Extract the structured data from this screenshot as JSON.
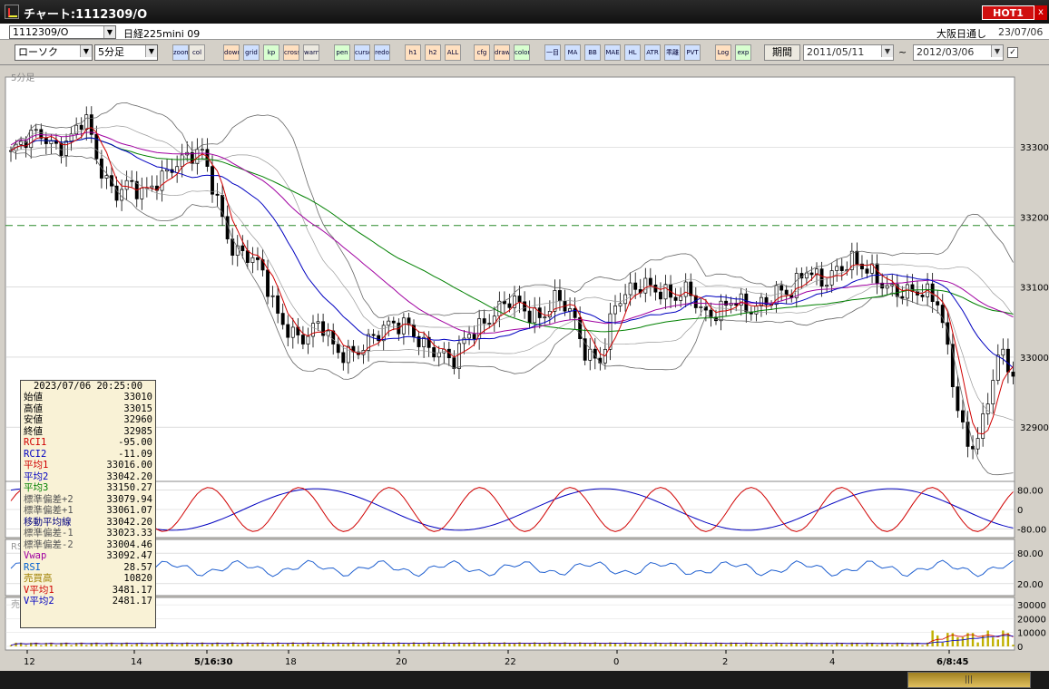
{
  "window": {
    "title": "チャート:1112309/O",
    "hot_label": "HOT1",
    "close_label": "x"
  },
  "header": {
    "code": "1112309/O",
    "name": "日経225mini 09",
    "market": "大阪日通し",
    "date": "23/07/06"
  },
  "toolbar": {
    "chart_type": "ローソク",
    "interval": "5分足",
    "period_label": "期間",
    "from_date": "2011/05/11",
    "to_date": "2012/03/06",
    "tilde": "~",
    "buttons": [
      "zoom",
      "col",
      "down",
      "grid",
      "kp",
      "cross",
      "warn",
      "pen",
      "cursor",
      "redo",
      "h1",
      "h2",
      "ALL",
      "cfg",
      "draw",
      "color",
      "一目",
      "MA",
      "BB",
      "MAE",
      "HL",
      "ATR",
      "乖離",
      "PVT",
      "Log",
      "exp"
    ]
  },
  "info_panel": {
    "timestamp": "2023/07/06  20:25:00",
    "rows": [
      {
        "label": "始値",
        "value": "33010",
        "color": "#000000"
      },
      {
        "label": "高値",
        "value": "33015",
        "color": "#000000"
      },
      {
        "label": "安値",
        "value": "32960",
        "color": "#000000"
      },
      {
        "label": "終値",
        "value": "32985",
        "color": "#000000"
      },
      {
        "label": "RCI1",
        "value": "-95.00",
        "color": "#d00000"
      },
      {
        "label": "RCI2",
        "value": "-11.09",
        "color": "#0000c0"
      },
      {
        "label": "平均1",
        "value": "33016.00",
        "color": "#d00000"
      },
      {
        "label": "平均2",
        "value": "33042.20",
        "color": "#0000c0"
      },
      {
        "label": "平均3",
        "value": "33150.27",
        "color": "#008000"
      },
      {
        "label": "標準偏差+2",
        "value": "33079.94",
        "color": "#555555"
      },
      {
        "label": "標準偏差+1",
        "value": "33061.07",
        "color": "#555555"
      },
      {
        "label": "移動平均線",
        "value": "33042.20",
        "color": "#000080"
      },
      {
        "label": "標準偏差-1",
        "value": "33023.33",
        "color": "#555555"
      },
      {
        "label": "標準偏差-2",
        "value": "33004.46",
        "color": "#555555"
      },
      {
        "label": "Vwap",
        "value": "33092.47",
        "color": "#a000a0"
      },
      {
        "label": "RSI",
        "value": "28.57",
        "color": "#0060d0"
      },
      {
        "label": "売買高",
        "value": "10820",
        "color": "#a08000"
      },
      {
        "label": "V平均1",
        "value": "3481.17",
        "color": "#d00000"
      },
      {
        "label": "V平均2",
        "value": "2481.17",
        "color": "#0000c0"
      }
    ]
  },
  "chart_data": {
    "type": "candlestick",
    "interval_label": "5分足",
    "price_axis": {
      "ticks": [
        33300,
        33200,
        33100,
        33000,
        32900
      ],
      "range": [
        32820,
        33400
      ]
    },
    "reference_line": 33188,
    "x_labels": [
      "12",
      "14",
      "5/16:30",
      "18",
      "20",
      "22",
      "0",
      "2",
      "4",
      "6/8:45"
    ],
    "close_path": [
      33290,
      33305,
      33320,
      33305,
      33310,
      33340,
      33270,
      33240,
      33250,
      33225,
      33250,
      33280,
      33290,
      33285,
      33220,
      33160,
      33150,
      33120,
      33060,
      33040,
      33030,
      33045,
      33005,
      33010,
      33020,
      33030,
      33045,
      33050,
      33020,
      33000,
      32990,
      33040,
      33050,
      33060,
      33080,
      33070,
      33060,
      33080,
      33060,
      33010,
      33000,
      33070,
      33090,
      33110,
      33100,
      33080,
      33090,
      33065,
      33070,
      33080,
      33060,
      33080,
      33100,
      33090,
      33120,
      33110,
      33130,
      33135,
      33120,
      33110,
      33100,
      33090,
      33085,
      33080,
      32960,
      32860,
      32900,
      33010,
      32985
    ],
    "rci_panel": {
      "ticks": [
        "80.00",
        "0",
        "-80.00"
      ]
    },
    "rsi_panel": {
      "ticks": [
        "80.00",
        "20.00"
      ]
    },
    "volume_panel": {
      "ticks": [
        "30000",
        "20000",
        "10000",
        "0"
      ]
    },
    "panel_labels": {
      "rsi": "RS",
      "volume": "売"
    }
  }
}
